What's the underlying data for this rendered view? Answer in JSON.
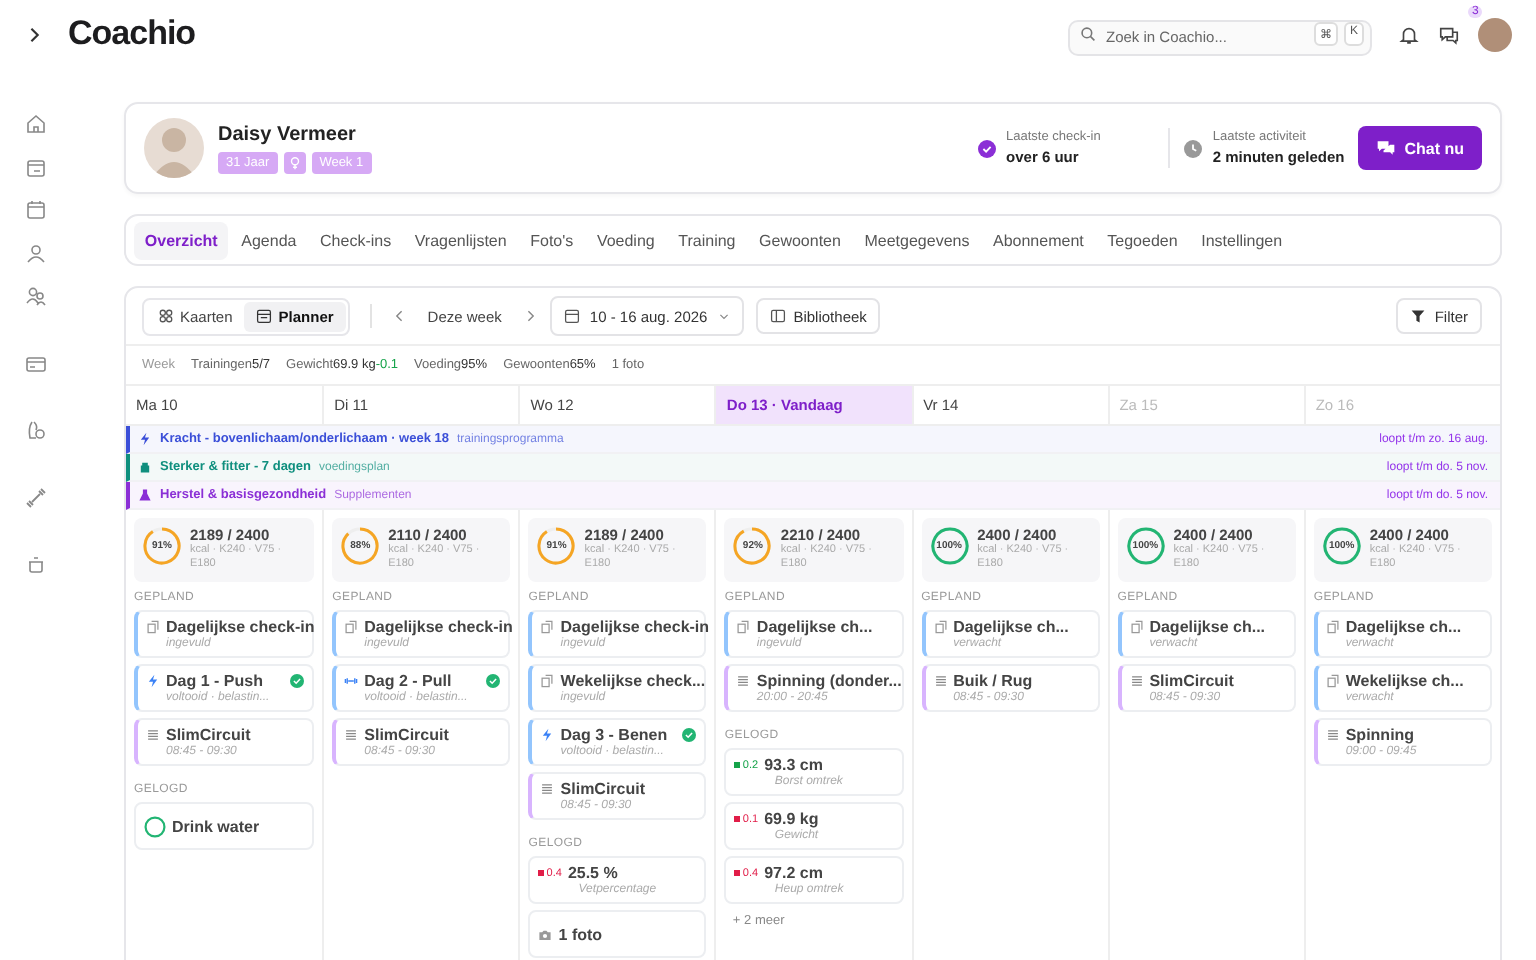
{
  "topbar": {
    "logo": "Coachio",
    "search": {
      "placeholder": "Zoek in Coachio...",
      "keys": [
        "⌘",
        "K"
      ]
    },
    "notification_badge": "3"
  },
  "client": {
    "name": "Daisy Vermeer",
    "tags": [
      {
        "kind": "text",
        "label": "31 Jaar"
      },
      {
        "kind": "female"
      },
      {
        "kind": "text",
        "label": "Week 1"
      }
    ],
    "checkin": {
      "label": "Laatste check-in",
      "value": "over 6 uur"
    },
    "activity": {
      "label": "Laatste activiteit",
      "value": "2 minuten geleden"
    },
    "chat_button": "Chat nu"
  },
  "tabs": [
    {
      "label": "Overzicht",
      "selected": true
    },
    {
      "label": "Agenda",
      "selected": false
    },
    {
      "label": "Check-ins",
      "selected": false
    },
    {
      "label": "Vragenlijsten",
      "selected": false
    },
    {
      "label": "Foto's",
      "selected": false
    },
    {
      "label": "Voeding",
      "selected": false
    },
    {
      "label": "Training",
      "selected": false
    },
    {
      "label": "Gewoonten",
      "selected": false
    },
    {
      "label": "Meetgegevens",
      "selected": false
    },
    {
      "label": "Abonnement",
      "selected": false
    },
    {
      "label": "Tegoeden",
      "selected": false
    },
    {
      "label": "Instellingen",
      "selected": false
    }
  ],
  "toolbar": {
    "views": [
      {
        "kind": "cards",
        "label": "Kaarten",
        "selected": false
      },
      {
        "kind": "planner",
        "label": "Planner",
        "selected": true
      }
    ],
    "period": "Deze week",
    "date_range": "10 - 16 aug. 2026",
    "library": "Bibliotheek",
    "filter": "Filter"
  },
  "stats": {
    "label": "Week",
    "items": [
      {
        "label": "Trainingen",
        "value": "5/7"
      },
      {
        "label": "Gewicht",
        "value": "69.9 kg",
        "delta": "-0.1"
      },
      {
        "label": "Voeding",
        "value": "95%"
      },
      {
        "label": "Gewoonten",
        "value": "65%"
      },
      {
        "label": "1 foto"
      }
    ]
  },
  "plans": [
    {
      "kind": "training",
      "title": "Kracht - bovenlichaam/onderlichaam · week 18",
      "tag": "trainingsprogramma",
      "until": "loopt t/m zo. 16 aug.",
      "color": "#3b4fd8"
    },
    {
      "kind": "nutrition",
      "title": "Sterker & fitter - 7 dagen",
      "tag": "voedingsplan",
      "until": "loopt t/m do. 5 nov.",
      "color": "#0f8f7e"
    },
    {
      "kind": "supplement",
      "title": "Herstel & basisgezondheid",
      "tag": "Supplementen",
      "until": "loopt t/m do. 5 nov.",
      "color": "#8b2fd6"
    }
  ],
  "days": [
    {
      "label": "Ma 10",
      "today": false,
      "weekend": false,
      "nutrition": {
        "percent": "91%",
        "level": 0.91,
        "color": "#f5a524",
        "total": "2189 / 2400",
        "macros": "kcal · K240 · V75 · E180"
      },
      "planned_label": "GEPLAND",
      "planned": [
        {
          "kind": "checkin",
          "title": "Dagelijkse check-in",
          "sub": "ingevuld",
          "done": false
        },
        {
          "kind": "strength",
          "title": "Dag 1 - Push",
          "sub": "voltooid · belastin...",
          "done": true
        },
        {
          "kind": "class",
          "title": "SlimCircuit",
          "sub": "08:45 - 09:30",
          "done": false
        }
      ],
      "logged_label": "GELOGD",
      "logged": [
        {
          "kind": "habit",
          "title": "Drink water"
        }
      ]
    },
    {
      "label": "Di 11",
      "today": false,
      "weekend": false,
      "nutrition": {
        "percent": "88%",
        "level": 0.88,
        "color": "#f5a524",
        "total": "2110 / 2400",
        "macros": "kcal · K240 · V75 · E180"
      },
      "planned_label": "GEPLAND",
      "planned": [
        {
          "kind": "checkin",
          "title": "Dagelijkse check-in",
          "sub": "ingevuld",
          "done": false
        },
        {
          "kind": "weights",
          "title": "Dag 2 - Pull",
          "sub": "voltooid · belastin...",
          "done": true
        },
        {
          "kind": "class",
          "title": "SlimCircuit",
          "sub": "08:45 - 09:30",
          "done": false
        }
      ]
    },
    {
      "label": "Wo 12",
      "today": false,
      "weekend": false,
      "nutrition": {
        "percent": "91%",
        "level": 0.91,
        "color": "#f5a524",
        "total": "2189 / 2400",
        "macros": "kcal · K240 · V75 · E180"
      },
      "planned_label": "GEPLAND",
      "planned": [
        {
          "kind": "checkin",
          "title": "Dagelijkse check-in",
          "sub": "ingevuld",
          "done": false
        },
        {
          "kind": "checkin",
          "title": "Wekelijkse check...",
          "sub": "ingevuld",
          "done": false
        },
        {
          "kind": "strength",
          "title": "Dag 3 - Benen",
          "sub": "voltooid · belastin...",
          "done": true
        },
        {
          "kind": "class",
          "title": "SlimCircuit",
          "sub": "08:45 - 09:30",
          "done": false
        }
      ],
      "logged_label": "GELOGD",
      "logged": [
        {
          "kind": "measurement",
          "delta": "0.4",
          "color": "#e11d48",
          "title": "25.5 %",
          "sub": "Vetpercentage"
        },
        {
          "kind": "photo",
          "title": "1 foto"
        }
      ]
    },
    {
      "label": "Do 13 · Vandaag",
      "today": true,
      "weekend": false,
      "nutrition": {
        "percent": "92%",
        "level": 0.92,
        "color": "#f5a524",
        "total": "2210 / 2400",
        "macros": "kcal · K240 · V75 · E180"
      },
      "planned_label": "GEPLAND",
      "planned": [
        {
          "kind": "checkin",
          "title": "Dagelijkse ch...",
          "sub": "ingevuld",
          "done": false
        },
        {
          "kind": "class",
          "title": "Spinning (donder...",
          "sub": "20:00 - 20:45",
          "done": false
        }
      ],
      "logged_label": "GELOGD",
      "logged": [
        {
          "kind": "measurement",
          "delta": "0.2",
          "color": "#16a34a",
          "title": "93.3 cm",
          "sub": "Borst omtrek"
        },
        {
          "kind": "measurement",
          "delta": "0.1",
          "color": "#e11d48",
          "title": "69.9 kg",
          "sub": "Gewicht"
        },
        {
          "kind": "measurement",
          "delta": "0.4",
          "color": "#e11d48",
          "title": "97.2 cm",
          "sub": "Heup omtrek"
        }
      ],
      "more": "+ 2 meer"
    },
    {
      "label": "Vr 14",
      "today": false,
      "weekend": false,
      "nutrition": {
        "percent": "100%",
        "level": 1,
        "color": "#22b573",
        "total": "2400 / 2400",
        "macros": "kcal · K240 · V75 · E180"
      },
      "planned_label": "GEPLAND",
      "planned": [
        {
          "kind": "checkin",
          "title": "Dagelijkse ch...",
          "sub": "verwacht",
          "done": false
        },
        {
          "kind": "class",
          "title": "Buik / Rug",
          "sub": "08:45 - 09:30",
          "done": false
        }
      ]
    },
    {
      "label": "Za 15",
      "today": false,
      "weekend": true,
      "nutrition": {
        "percent": "100%",
        "level": 1,
        "color": "#22b573",
        "total": "2400 / 2400",
        "macros": "kcal · K240 · V75 · E180"
      },
      "planned_label": "GEPLAND",
      "planned": [
        {
          "kind": "checkin",
          "title": "Dagelijkse ch...",
          "sub": "verwacht",
          "done": false
        },
        {
          "kind": "class",
          "title": "SlimCircuit",
          "sub": "08:45 - 09:30",
          "done": false
        }
      ]
    },
    {
      "label": "Zo 16",
      "today": false,
      "weekend": true,
      "nutrition": {
        "percent": "100%",
        "level": 1,
        "color": "#22b573",
        "total": "2400 / 2400",
        "macros": "kcal · K240 · V75 · E180"
      },
      "planned_label": "GEPLAND",
      "planned": [
        {
          "kind": "checkin",
          "title": "Dagelijkse ch...",
          "sub": "verwacht",
          "done": false
        },
        {
          "kind": "checkin",
          "title": "Wekelijkse ch...",
          "sub": "verwacht",
          "done": false
        },
        {
          "kind": "class",
          "title": "Spinning",
          "sub": "09:00 - 09:45",
          "done": false
        }
      ]
    }
  ]
}
